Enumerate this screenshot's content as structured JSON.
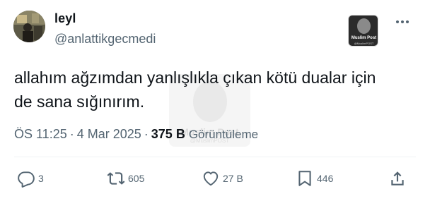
{
  "author": {
    "display_name": "leyl",
    "handle": "@anlattikgecmedi"
  },
  "watermark": {
    "title": "Muslim Post",
    "subtitle": "@MuslimPOST"
  },
  "tweet": {
    "text_line1": "allahım ağzımdan yanlışlıkla çıkan kötü dualar için",
    "text_line2": "de sana sığınırım."
  },
  "meta": {
    "time": "ÖS 11:25",
    "separator": "·",
    "date": "4 Mar 2025",
    "views_count": "375 B",
    "views_label": "Görüntüleme"
  },
  "actions": {
    "replies": "3",
    "reposts": "605",
    "likes": "27 B",
    "bookmarks": "446"
  },
  "colors": {
    "primary_text": "#0f1419",
    "secondary_text": "#536471",
    "divider": "#eff3f4"
  }
}
